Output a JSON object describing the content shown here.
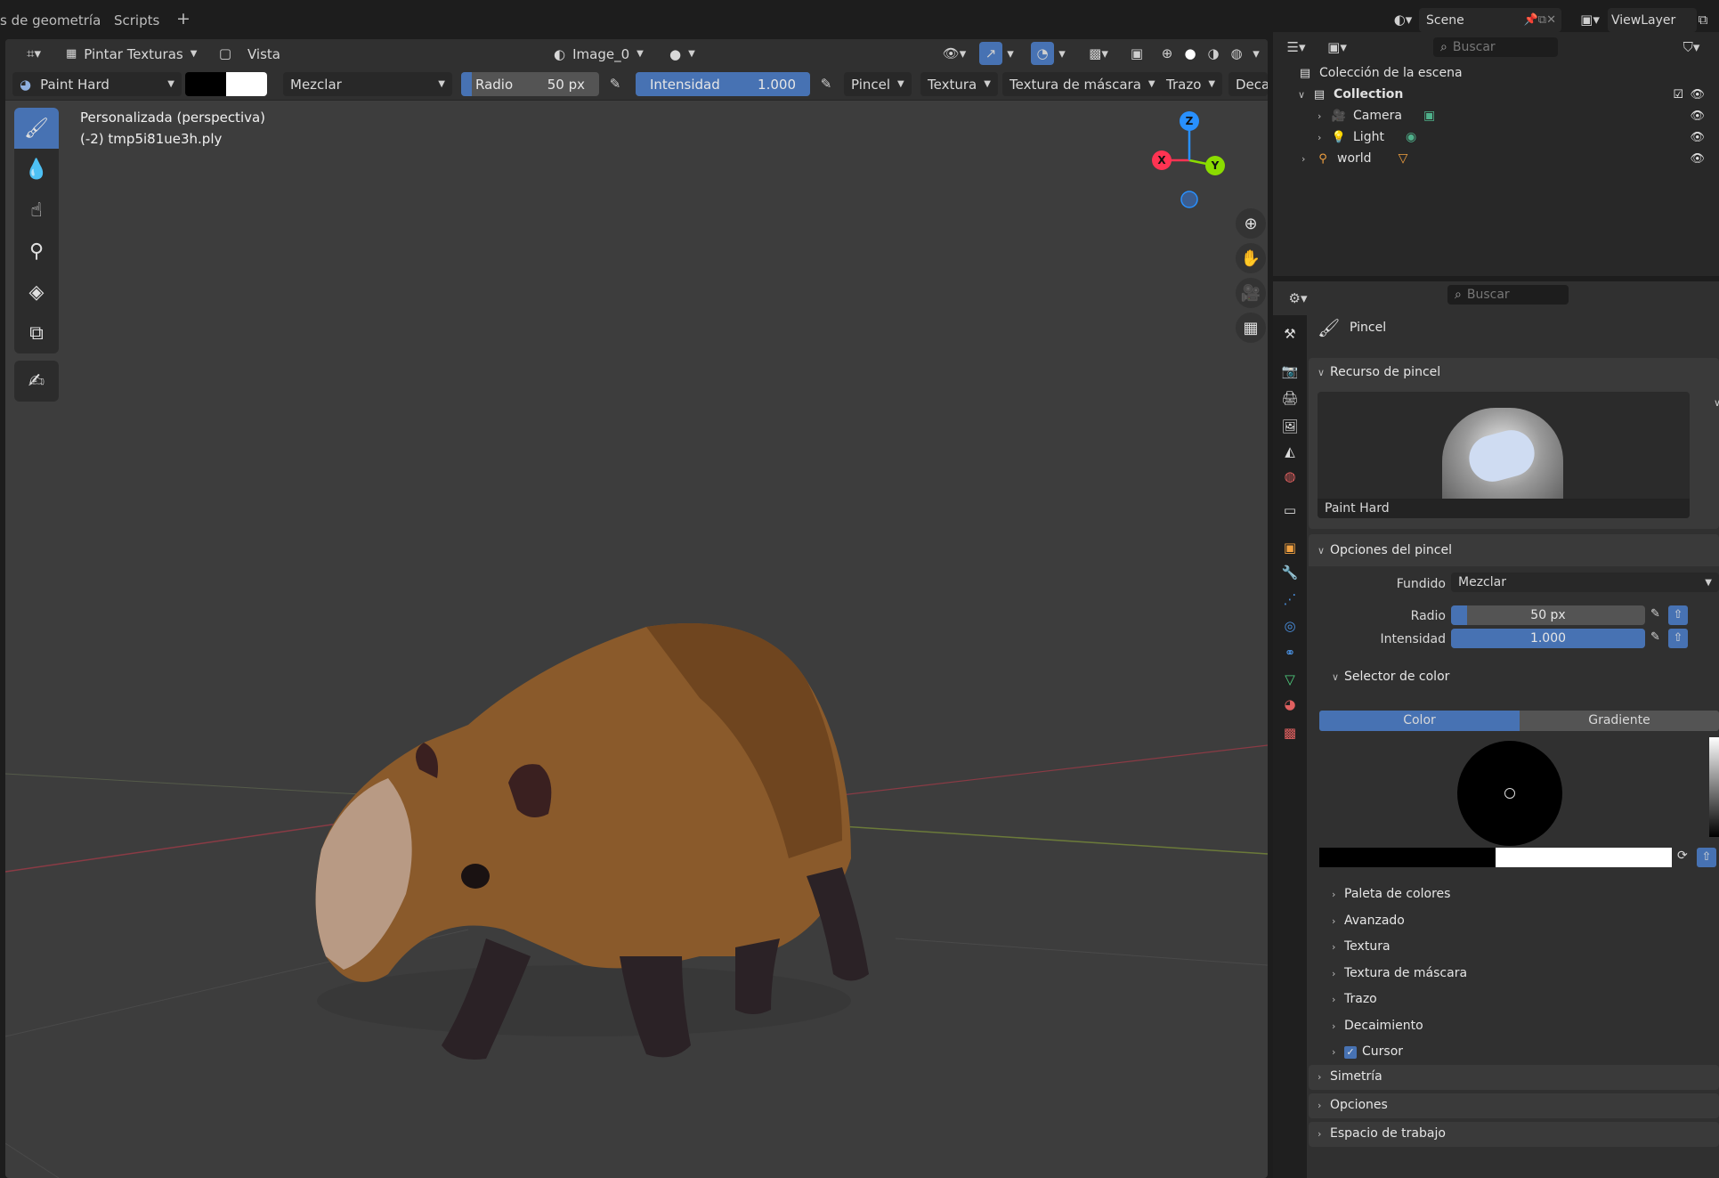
{
  "topbar": {
    "tab_geometry": "s de geometría",
    "tab_scripts": "Scripts",
    "add_tab": "+",
    "scene_name": "Scene",
    "view_layer": "ViewLayer"
  },
  "viewport_header": {
    "mode": "Pintar Texturas",
    "view_menu": "Vista",
    "image_name": "Image_0"
  },
  "tool_header": {
    "brush_name": "Paint Hard",
    "blend_mode": "Mezclar",
    "radius_label": "Radio",
    "radius_value": "50 px",
    "strength_label": "Intensidad",
    "strength_value": "1.000",
    "menu_brush": "Pincel",
    "menu_texture": "Textura",
    "menu_mask_texture": "Textura de máscara",
    "menu_stroke": "Trazo",
    "menu_falloff": "Decai"
  },
  "viewport": {
    "view_name": "Personalizada (perspectiva)",
    "object_name": "(-2) tmp5i81ue3h.ply",
    "gizmo_axes": [
      "X",
      "Y",
      "Z"
    ]
  },
  "outliner": {
    "search_placeholder": "Buscar",
    "scene_collection": "Colección de la escena",
    "items": [
      {
        "label": "Collection"
      },
      {
        "label": "Camera"
      },
      {
        "label": "Light"
      },
      {
        "label": "world"
      }
    ]
  },
  "properties": {
    "search_placeholder": "Buscar",
    "context_title": "Pincel",
    "brush_asset_section": "Recurso de pincel",
    "brush_asset_name": "Paint Hard",
    "brush_settings_section": "Opciones del pincel",
    "blend_label": "Fundido",
    "blend_value": "Mezclar",
    "radius_label": "Radio",
    "radius_value": "50 px",
    "strength_label": "Intensidad",
    "strength_value": "1.000",
    "color_picker_section": "Selector de color",
    "color_tab": "Color",
    "gradient_tab": "Gradiente",
    "subpanels": [
      "Paleta de colores",
      "Avanzado",
      "Textura",
      "Textura de máscara",
      "Trazo",
      "Decaimiento",
      "Cursor"
    ],
    "sections": [
      "Simetría",
      "Opciones",
      "Espacio de trabajo"
    ]
  },
  "colors": {
    "accent": "#4772b3",
    "viewport_bg": "#3d3d3d",
    "panel_bg": "#303030",
    "axis_x": "#ff3352",
    "axis_y": "#8bdc00",
    "axis_z": "#2890ff"
  }
}
